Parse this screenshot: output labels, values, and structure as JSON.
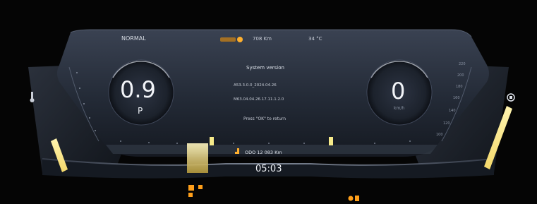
{
  "status_bar": {
    "drive_mode": "NORMAL",
    "range": "708 Km",
    "temperature": "34 °C"
  },
  "left_gauge": {
    "value": "0.9",
    "gear": "P",
    "fuel_level": 0.35
  },
  "right_gauge": {
    "value": "0",
    "unit": "km/h",
    "ticks": [
      "220",
      "200",
      "180",
      "160",
      "140",
      "120",
      "100"
    ],
    "battery_level": 0.7
  },
  "center": {
    "title": "System version",
    "version_1": "A53.3.0.0_2024.04.26",
    "version_2": "M63.04.04.26.17.11.1.2.0",
    "instruction": "Press \"OK\" to return"
  },
  "bottom": {
    "odo": "ODO 12 083 Km",
    "time": "05:03"
  },
  "colors": {
    "accent": "#ffb02e",
    "highlight": "#f6ea8a",
    "panel": "#2a3140"
  },
  "icons": [
    "temperature-icon",
    "battery-icon",
    "warning-icon",
    "wrench-icon",
    "seatbelt-icon",
    "headlight-icon"
  ]
}
